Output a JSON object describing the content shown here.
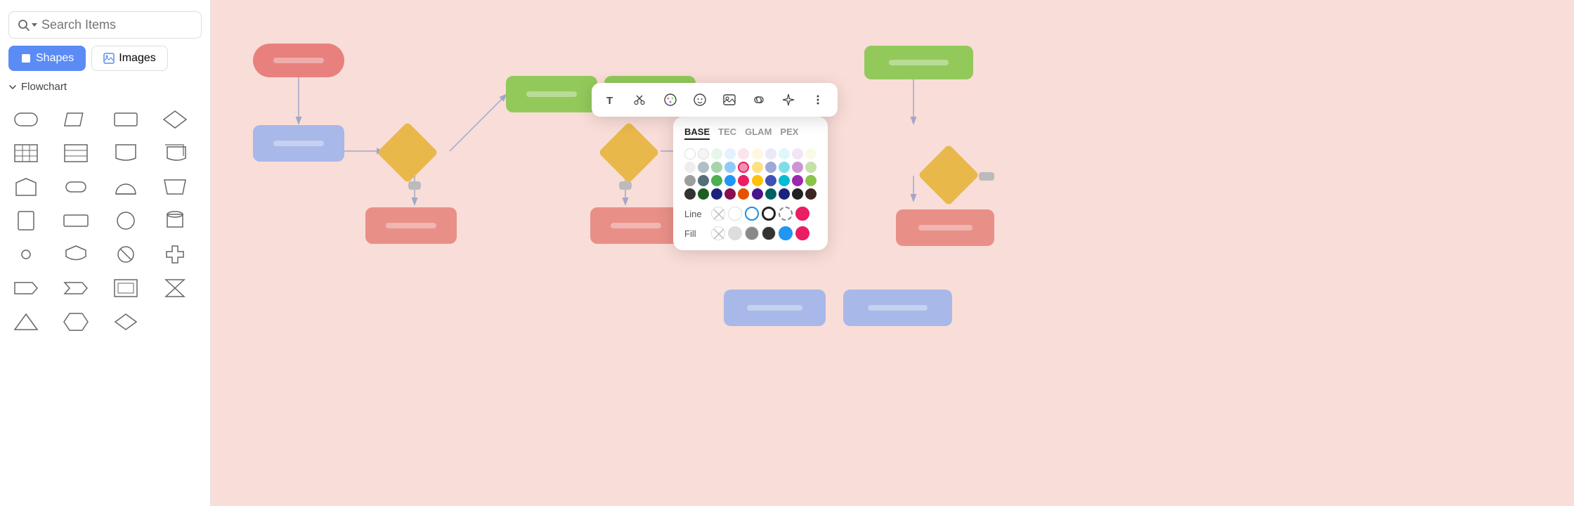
{
  "sidebar": {
    "search_placeholder": "Search Items",
    "tabs": [
      {
        "label": "Shapes",
        "id": "shapes",
        "active": true
      },
      {
        "label": "Images",
        "id": "images",
        "active": false
      }
    ],
    "section_label": "Flowchart"
  },
  "toolbar": {
    "icons": [
      "T",
      "✂",
      "☺",
      "😊",
      "⬜",
      "🔗",
      "✦",
      "⋮"
    ]
  },
  "color_picker": {
    "tabs": [
      "BASE",
      "TEC",
      "GLAM",
      "PEX"
    ],
    "active_tab": "BASE",
    "line_label": "Line",
    "fill_label": "Fill"
  },
  "flowchart": {
    "node_label": "——"
  }
}
